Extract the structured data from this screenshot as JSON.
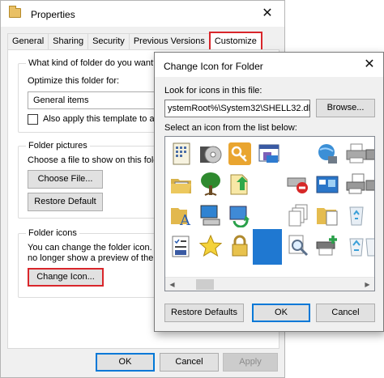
{
  "properties": {
    "title": "Properties",
    "close_glyph": "✕",
    "tabs": [
      {
        "label": "General"
      },
      {
        "label": "Sharing"
      },
      {
        "label": "Security"
      },
      {
        "label": "Previous Versions"
      },
      {
        "label": "Customize"
      }
    ],
    "optimize": {
      "group_label": "What kind of folder do you want?",
      "prompt": "Optimize this folder for:",
      "selected": "General items",
      "apply_template_label": "Also apply this template to all su"
    },
    "folder_pictures": {
      "group_label": "Folder pictures",
      "prompt": "Choose a file to show on this folder",
      "choose_file_label": "Choose File...",
      "restore_default_label": "Restore Default"
    },
    "folder_icons": {
      "group_label": "Folder icons",
      "desc_line1": "You can change the folder icon. If",
      "desc_line2": "no longer show a preview of the fo",
      "change_icon_label": "Change Icon..."
    },
    "footer": {
      "ok_label": "OK",
      "cancel_label": "Cancel",
      "apply_label": "Apply"
    }
  },
  "change_icon": {
    "title": "Change Icon for  Folder",
    "close_glyph": "✕",
    "look_for_label": "Look for icons in this file:",
    "path_value": "ystemRoot%\\System32\\SHELL32.dll",
    "browse_label": "Browse...",
    "select_label": "Select an icon from the list below:",
    "scroll_left": "◀",
    "scroll_right": "▶",
    "restore_defaults_label": "Restore Defaults",
    "ok_label": "OK",
    "cancel_label": "Cancel",
    "icons": [
      [
        "generic-file-icon",
        "cd-drive-icon",
        "key-icon",
        "program-window-icon",
        "",
        "",
        "network-globe-icon",
        "printer-icon"
      ],
      [
        "open-folder-icon",
        "tree-icon",
        "shortcut-arrow-icon",
        "",
        "no-entry-device-icon",
        "desktop-icon",
        "printer-file-icon",
        "network-printer-icon"
      ],
      [
        "font-folder-icon",
        "computer-icon",
        "sync-folder-icon",
        "",
        "documents-stack-icon",
        "folder-file-icon",
        "recycle-bin-empty-icon",
        "recycle-bin-icon"
      ],
      [
        "checklist-icon",
        "star-icon",
        "padlock-icon",
        "selected-blank-icon",
        "magnifier-file-icon",
        "network-add-icon",
        "recycle-bin-full-icon",
        "recycle-bin-clean-icon"
      ]
    ]
  }
}
